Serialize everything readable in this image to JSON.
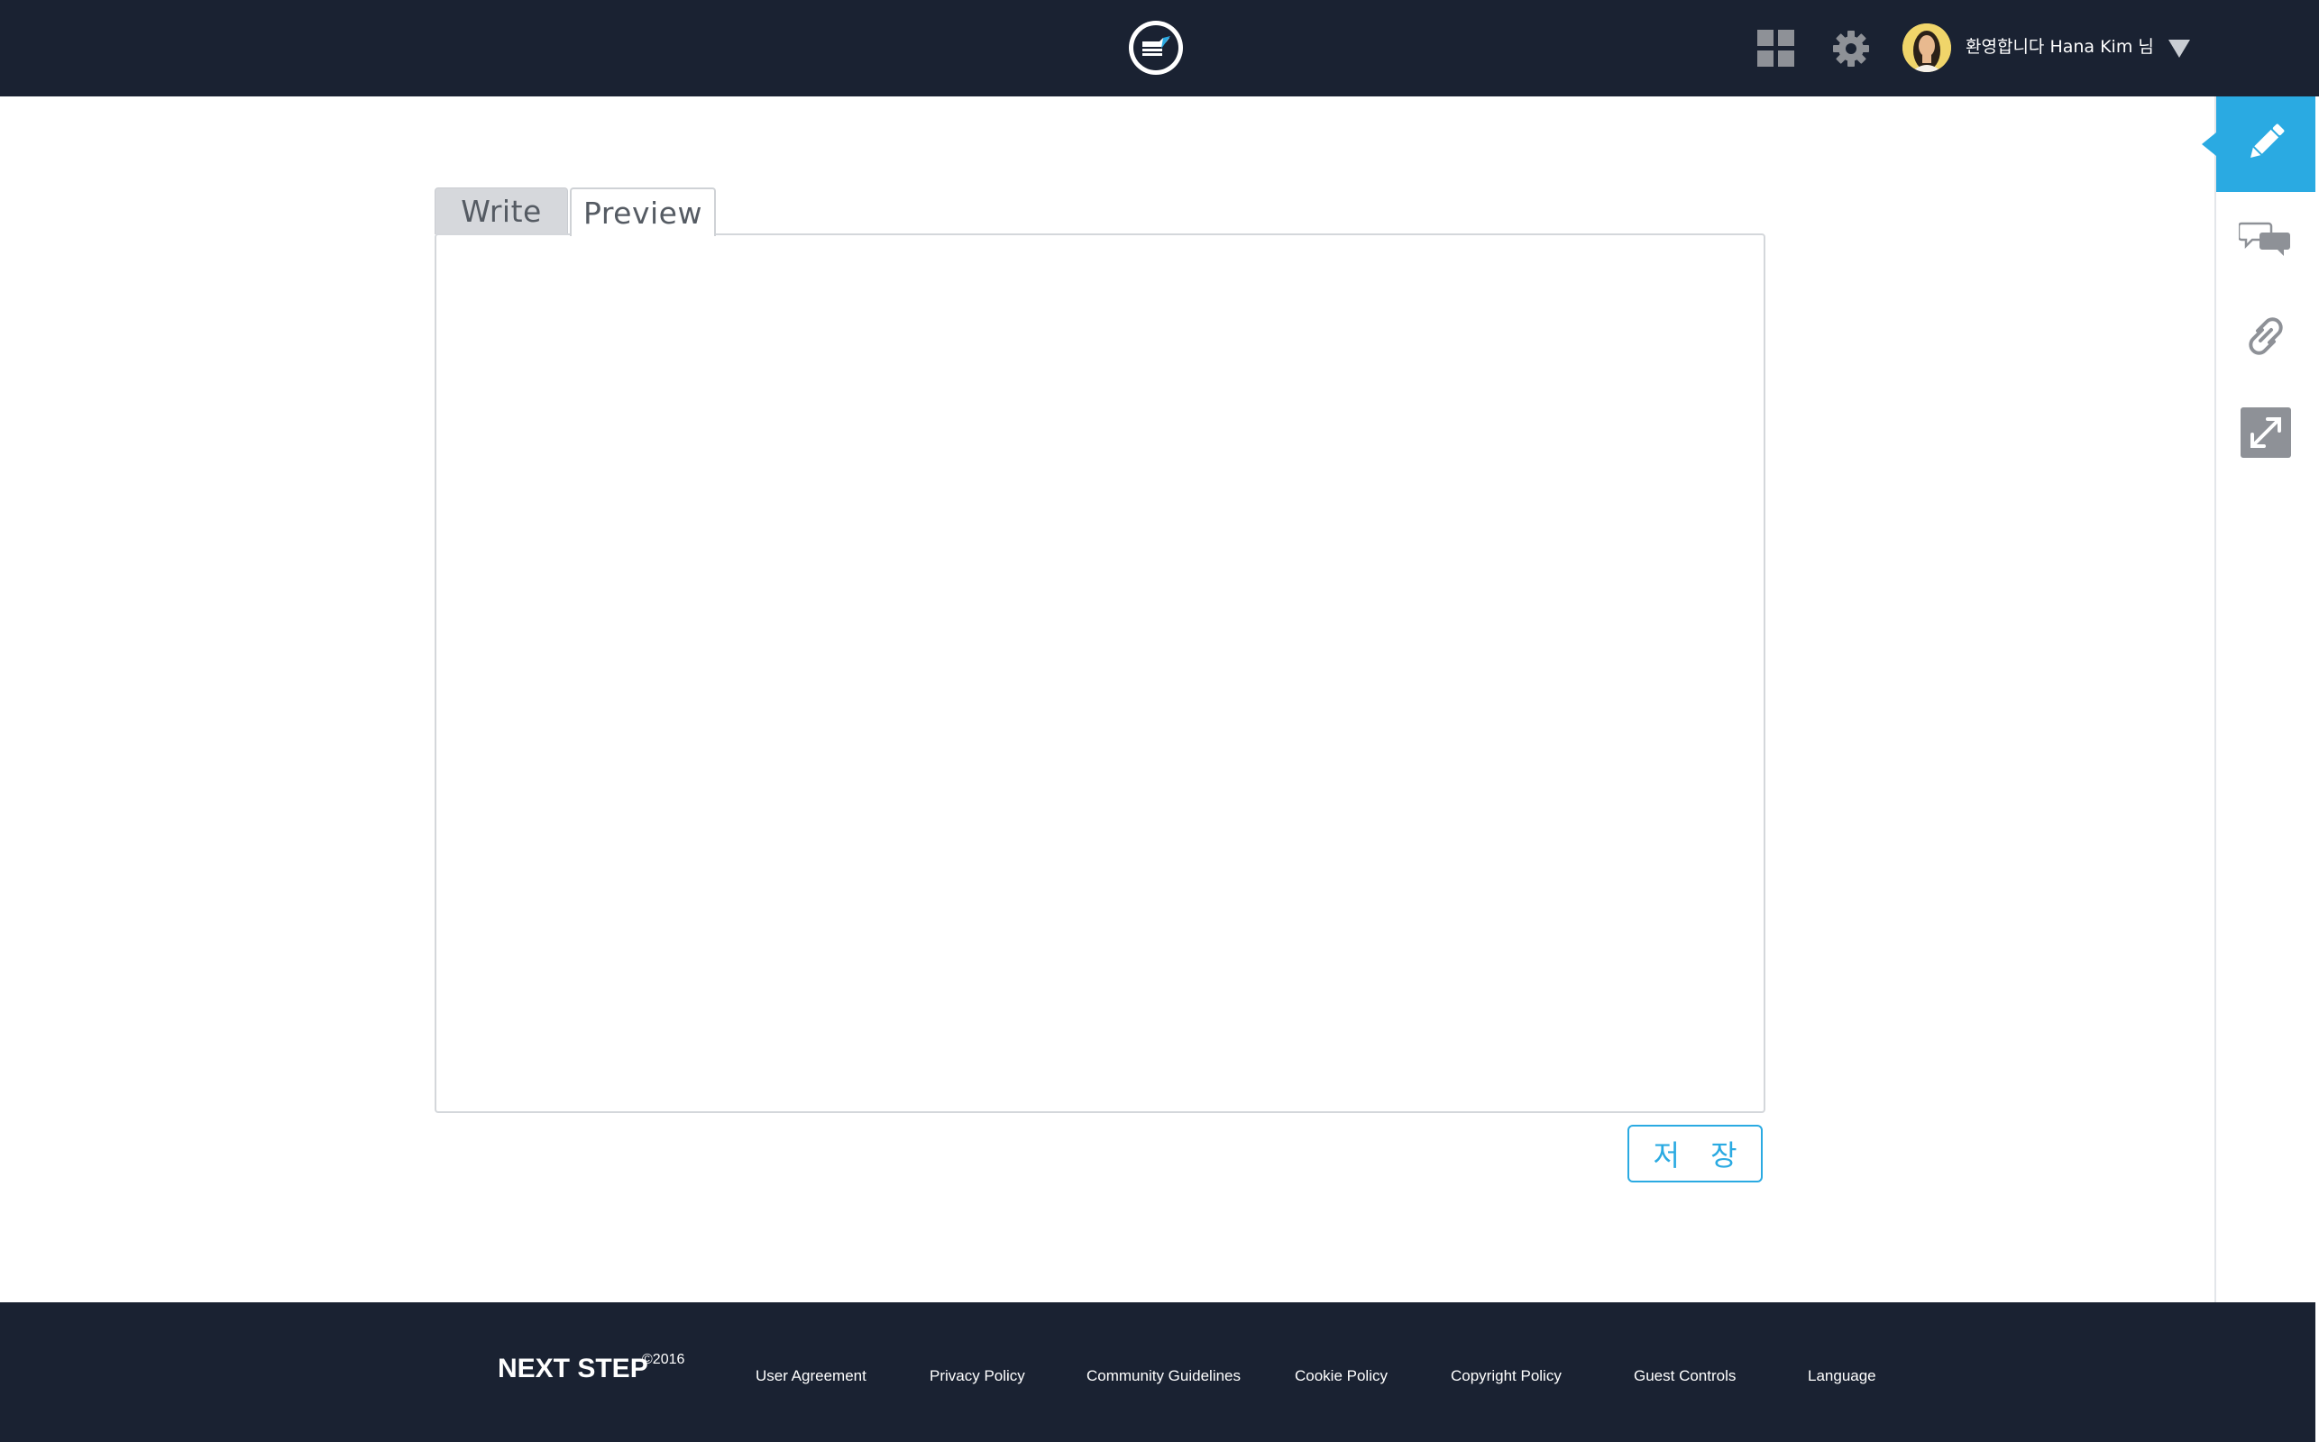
{
  "header": {
    "logo_icon": "notebook-logo-icon",
    "apps_icon": "grid-icon",
    "settings_icon": "gear-icon",
    "greeting": "환영합니다 Hana Kim 님",
    "dropdown_icon": "caret-down-icon"
  },
  "editor": {
    "tabs": [
      {
        "label": "Write",
        "selected": false
      },
      {
        "label": "Preview",
        "selected": true
      }
    ],
    "content": "",
    "save_label": "저 장"
  },
  "sidebar": {
    "items": [
      {
        "icon": "pencil-icon",
        "active": true
      },
      {
        "icon": "chat-bubbles-icon",
        "active": false
      },
      {
        "icon": "link-icon",
        "active": false
      },
      {
        "icon": "expand-icon",
        "active": false
      }
    ]
  },
  "footer": {
    "brand": "NEXT STEP",
    "year": "©2016",
    "links": [
      "User Agreement",
      "Privacy Policy",
      "Community Guidelines",
      "Cookie Policy",
      "Copyright Policy",
      "Guest Controls",
      "Language"
    ]
  },
  "colors": {
    "navbar": "#1a2232",
    "accent": "#2aaae2",
    "icon_gray": "#8e9197"
  }
}
